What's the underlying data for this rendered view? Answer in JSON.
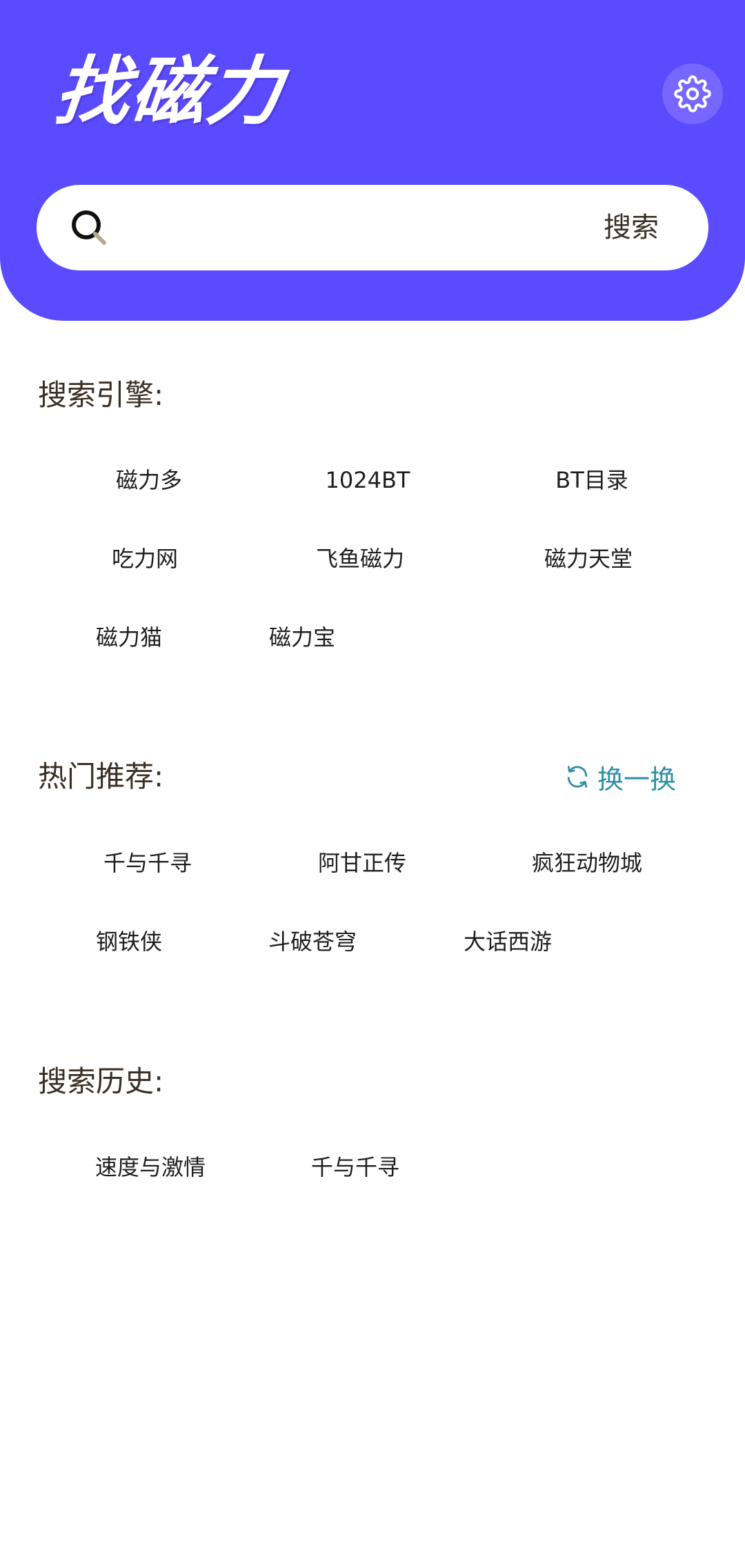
{
  "app": {
    "logo_text": "找磁力"
  },
  "search": {
    "placeholder": "",
    "submit_label": "搜索"
  },
  "engines": {
    "title": "搜索引擎:",
    "items": [
      "磁力多",
      "1024BT",
      "BT目录",
      "吃力网",
      "飞鱼磁力",
      "磁力天堂",
      "磁力猫",
      "磁力宝"
    ]
  },
  "hot": {
    "title": "热门推荐:",
    "refresh_label": "换一换",
    "items": [
      "千与千寻",
      "阿甘正传",
      "疯狂动物城",
      "钢铁侠",
      "斗破苍穹",
      "大话西游"
    ]
  },
  "history": {
    "title": "搜索历史:",
    "items": [
      "速度与激情",
      "千与千寻"
    ]
  },
  "colors": {
    "header_bg": "#5b4bff",
    "accent_link": "#2f8fa6",
    "title_text": "#3a2f22"
  },
  "icons": {
    "settings": "gear-icon",
    "search": "search-icon",
    "refresh": "refresh-icon"
  }
}
